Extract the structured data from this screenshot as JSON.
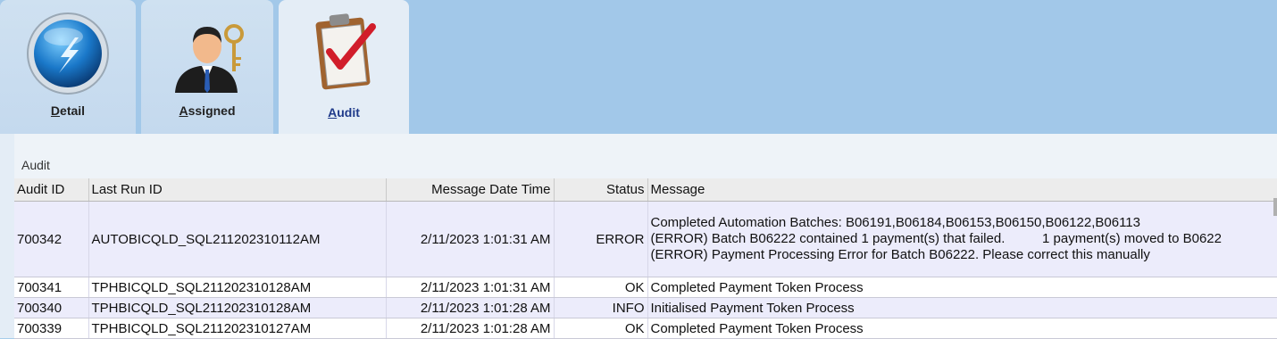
{
  "tabs": [
    {
      "label": "Detail",
      "icon": "lightning-orb-icon"
    },
    {
      "label": "Assigned",
      "icon": "person-key-icon"
    },
    {
      "label": "Audit",
      "icon": "clipboard-check-icon"
    }
  ],
  "audit": {
    "title": "Audit",
    "columns": {
      "audit_id": "Audit ID",
      "last_run_id": "Last Run ID",
      "message_date_time": "Message Date Time",
      "status": "Status",
      "message": "Message"
    },
    "rows": [
      {
        "audit_id": "700342",
        "last_run_id": "AUTOBICQLD_SQL211202310112AM",
        "message_date_time": "2/11/2023 1:01:31 AM",
        "status": "ERROR",
        "message_lines": [
          "Completed Automation Batches: B06191,B06184,B06153,B06150,B06122,B06113",
          "(ERROR) Batch B06222 contained 1 payment(s) that failed.          1 payment(s) moved to B0622",
          "(ERROR) Payment Processing Error for Batch B06222. Please correct this manually"
        ]
      },
      {
        "audit_id": "700341",
        "last_run_id": "TPHBICQLD_SQL211202310128AM",
        "message_date_time": "2/11/2023 1:01:31 AM",
        "status": "OK",
        "message_lines": [
          "Completed Payment Token Process"
        ]
      },
      {
        "audit_id": "700340",
        "last_run_id": "TPHBICQLD_SQL211202310128AM",
        "message_date_time": "2/11/2023 1:01:28 AM",
        "status": "INFO",
        "message_lines": [
          "Initialised Payment Token Process"
        ]
      },
      {
        "audit_id": "700339",
        "last_run_id": "TPHBICQLD_SQL211202310127AM",
        "message_date_time": "2/11/2023 1:01:28 AM",
        "status": "OK",
        "message_lines": [
          "Completed Payment Token Process"
        ]
      }
    ]
  }
}
